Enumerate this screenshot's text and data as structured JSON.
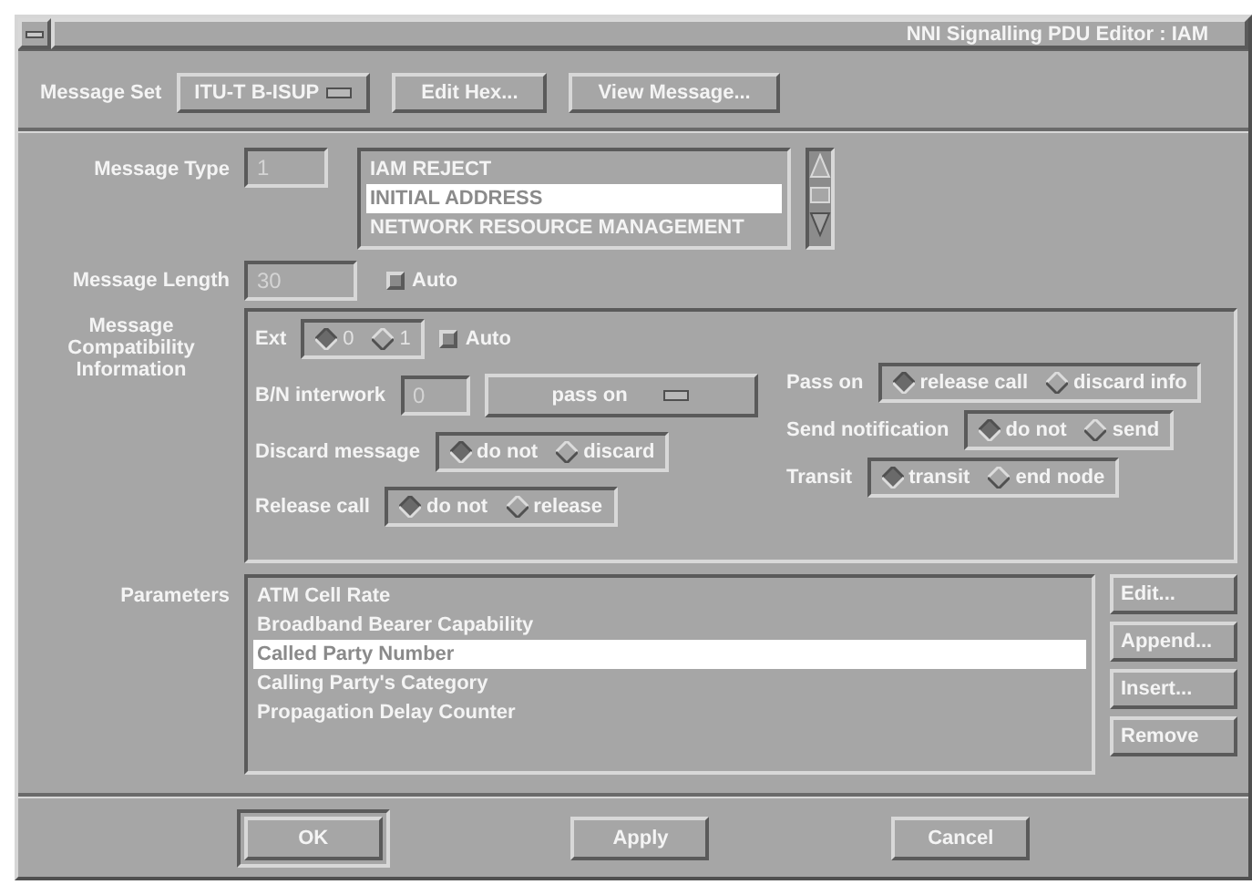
{
  "window": {
    "title": "NNI Signalling PDU Editor : IAM"
  },
  "toolbar": {
    "message_set_label": "Message Set",
    "message_set_value": "ITU-T B-ISUP",
    "buttons": [
      "Edit Hex...",
      "View Message..."
    ]
  },
  "message_type": {
    "label": "Message Type",
    "value": "1",
    "disabled": true,
    "items": [
      {
        "label": "IAM REJECT",
        "selected": false
      },
      {
        "label": "INITIAL ADDRESS",
        "selected": true
      },
      {
        "label": "NETWORK RESOURCE MANAGEMENT",
        "selected": false
      }
    ]
  },
  "message_length": {
    "label": "Message Length",
    "value": "30",
    "disabled": true,
    "auto": {
      "label": "Auto",
      "checked": false
    }
  },
  "compatibility": {
    "label": "Message Compatibility Information",
    "ext": {
      "label": "Ext",
      "disabled": true,
      "options": [
        {
          "label": "0",
          "selected": true
        },
        {
          "label": "1",
          "selected": false
        }
      ],
      "auto": {
        "label": "Auto",
        "checked": false
      }
    },
    "bn_interwork": {
      "label": "B/N interwork",
      "value": "0",
      "disabled": true,
      "option": "pass on"
    },
    "left": [
      {
        "label": "Discard message",
        "options": [
          {
            "label": "do not",
            "selected": true
          },
          {
            "label": "discard",
            "selected": false
          }
        ]
      },
      {
        "label": "Release call",
        "options": [
          {
            "label": "do not",
            "selected": true
          },
          {
            "label": "release",
            "selected": false
          }
        ]
      }
    ],
    "right": [
      {
        "label": "Pass on",
        "options": [
          {
            "label": "release call",
            "selected": true
          },
          {
            "label": "discard info",
            "selected": false
          }
        ]
      },
      {
        "label": "Send notification",
        "options": [
          {
            "label": "do not",
            "selected": true
          },
          {
            "label": "send",
            "selected": false
          }
        ]
      },
      {
        "label": "Transit",
        "options": [
          {
            "label": "transit",
            "selected": true
          },
          {
            "label": "end node",
            "selected": false
          }
        ]
      }
    ]
  },
  "parameters": {
    "label": "Parameters",
    "items": [
      {
        "label": "ATM Cell Rate",
        "selected": false
      },
      {
        "label": "Broadband Bearer Capability",
        "selected": false
      },
      {
        "label": "Called Party Number",
        "selected": true
      },
      {
        "label": "Calling Party's Category",
        "selected": false
      },
      {
        "label": "Propagation Delay Counter",
        "selected": false
      }
    ],
    "buttons": [
      "Edit...",
      "Append...",
      "Insert...",
      "Remove"
    ]
  },
  "footer": [
    {
      "label": "OK",
      "default": true
    },
    {
      "label": "Apply",
      "default": false
    },
    {
      "label": "Cancel",
      "default": false
    }
  ]
}
